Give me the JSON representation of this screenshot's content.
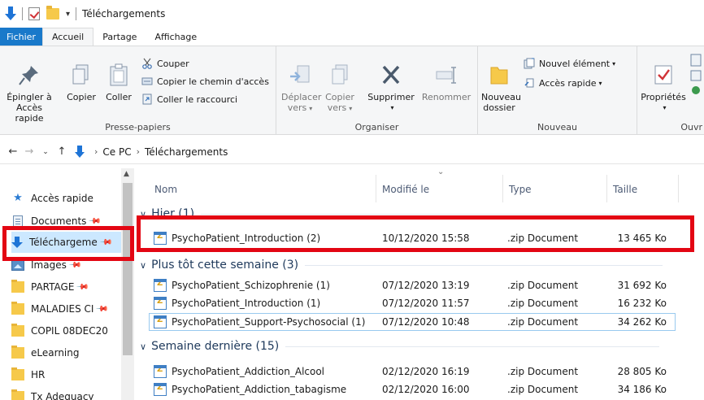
{
  "window": {
    "title": "Téléchargements"
  },
  "tabs": [
    "Fichier",
    "Accueil",
    "Partage",
    "Affichage"
  ],
  "ribbon": {
    "clipboard": {
      "group_label": "Presse-papiers",
      "pin_line1": "Épingler à",
      "pin_line2": "Accès rapide",
      "copy": "Copier",
      "paste": "Coller",
      "cut": "Couper",
      "copy_path": "Copier le chemin d'accès",
      "paste_shortcut": "Coller le raccourci"
    },
    "organize": {
      "group_label": "Organiser",
      "move_line1": "Déplacer",
      "move_line2": "vers",
      "copyto_line1": "Copier",
      "copyto_line2": "vers",
      "delete": "Supprimer",
      "rename": "Renommer"
    },
    "new": {
      "group_label": "Nouveau",
      "folder_line1": "Nouveau",
      "folder_line2": "dossier",
      "new_item": "Nouvel élément",
      "easy_access": "Accès rapide"
    },
    "open": {
      "group_label": "Ouvr",
      "properties": "Propriétés"
    }
  },
  "address": {
    "crumbs": [
      "Ce PC",
      "Téléchargements"
    ]
  },
  "nav": {
    "items": [
      {
        "label": "Accès rapide",
        "icon": "star-icon"
      },
      {
        "label": "Documents",
        "icon": "document-icon"
      },
      {
        "label": "Téléchargeme",
        "icon": "download-icon"
      },
      {
        "label": "Images",
        "icon": "picture-icon"
      },
      {
        "label": "PARTAGE",
        "icon": "folder-icon"
      },
      {
        "label": "MALADIES CI",
        "icon": "folder-icon"
      },
      {
        "label": "COPIL 08DEC20",
        "icon": "folder-icon"
      },
      {
        "label": "eLearning",
        "icon": "folder-icon"
      },
      {
        "label": "HR",
        "icon": "folder-icon"
      },
      {
        "label": "Tx Adequacy",
        "icon": "folder-icon"
      }
    ]
  },
  "columns": {
    "name": "Nom",
    "modified": "Modifié le",
    "type": "Type",
    "size": "Taille"
  },
  "groups": [
    {
      "label": "Hier (1)",
      "files": [
        {
          "name": "PsychoPatient_Introduction (2)",
          "modified": "10/12/2020 15:58",
          "type": ".zip Document",
          "size": "13 465 Ko"
        }
      ]
    },
    {
      "label": "Plus tôt cette semaine (3)",
      "files": [
        {
          "name": "PsychoPatient_Schizophrenie (1)",
          "modified": "07/12/2020 13:19",
          "type": ".zip Document",
          "size": "31 692 Ko"
        },
        {
          "name": "PsychoPatient_Introduction (1)",
          "modified": "07/12/2020 11:57",
          "type": ".zip Document",
          "size": "16 232 Ko"
        },
        {
          "name": "PsychoPatient_Support-Psychosocial (1)",
          "modified": "07/12/2020 10:48",
          "type": ".zip Document",
          "size": "34 262 Ko"
        }
      ]
    },
    {
      "label": "Semaine dernière (15)",
      "files": [
        {
          "name": "PsychoPatient_Addiction_Alcool",
          "modified": "02/12/2020 16:19",
          "type": ".zip Document",
          "size": "28 805 Ko"
        },
        {
          "name": "PsychoPatient_Addiction_tabagisme",
          "modified": "02/12/2020 16:00",
          "type": ".zip Document",
          "size": "34 186 Ko"
        }
      ]
    }
  ],
  "colors": {
    "file_tab": "#1979ca",
    "highlight": "#e30613",
    "selection": "#cce8ff"
  }
}
